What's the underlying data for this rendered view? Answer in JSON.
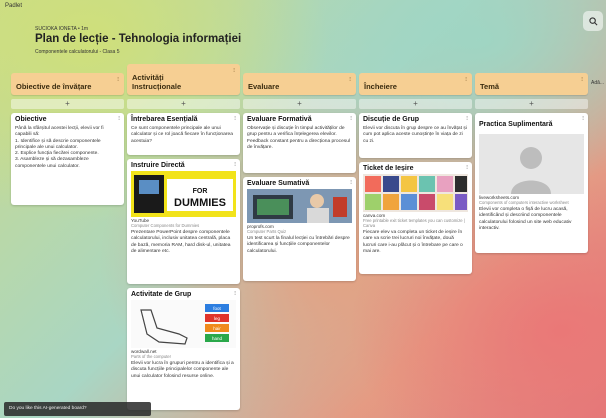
{
  "app": {
    "brand": "Padlet",
    "search_icon": "search-icon"
  },
  "header": {
    "breadcrumb": "SUCIOKA IONETA • 1m",
    "title": "Plan de lecție - Tehnologia informației",
    "subtitle": "Componentele calculatorului - Clasa 5"
  },
  "columns": [
    {
      "label": "Obiective de învățare"
    },
    {
      "label": "Activități Instrucționale"
    },
    {
      "label": "Evaluare"
    },
    {
      "label": "Încheiere"
    },
    {
      "label": "Temă"
    }
  ],
  "add_label": "+",
  "extra_column_hint": "Adă...",
  "cards": {
    "objective": {
      "title": "Obiective",
      "body": "Până la sfârșitul acestei lecții, elevii vor fi capabili să:\n1. Identifice și să descrie componentele principale ale unui calculator.\n2. Explice funcția fiecărei componente.\n3. Asambleze și să dezasambleze componentele unui calculator."
    },
    "essential": {
      "title": "Întrebarea Esențială",
      "body": "Ce sunt componentele principale ale unui calculator și ce rol joacă fiecare în funcționarea acestuia?"
    },
    "direct": {
      "title": "Instruire Directă",
      "source": "YouTube",
      "source2": "Computer Components for Dummies",
      "body": "Prezentare PowerPoint despre componentele calculatorului, inclusiv unitatea centrală, placa de bază, memoria RAM, hard disk-ul, unitatea de alimentare etc.",
      "thumb_text": [
        "DUMMIES",
        "FOR"
      ]
    },
    "group": {
      "title": "Activitate de Grup",
      "source": "wordwall.net",
      "source2": "Parts of the computer",
      "body": "Elevii vor lucra în grupuri pentru a identifica și a discuta funcțiile principalelor componente ale unui calculator folosind resurse online.",
      "tags": [
        "foot",
        "leg",
        "hair",
        "hand"
      ]
    },
    "formative": {
      "title": "Evaluare Formativă",
      "body": "Observație și discuție în timpul activităților de grup pentru a verifica înțelegerea elevilor. Feedback constant pentru a direcționa procesul de învățare."
    },
    "summative": {
      "title": "Evaluare Sumativă",
      "source": "proprofs.com",
      "source2": "Computer Parts Quiz",
      "body": "Un test scurt la finalul lecției cu întrebări despre identificarea și funcțiile componentelor calculatorului."
    },
    "discussion": {
      "title": "Discuție de Grup",
      "body": "Elevii vor discuta în grup despre ce au învățat și cum pot aplica aceste cunoștințe în viața de zi cu zi."
    },
    "exit": {
      "title": "Ticket de Ieșire",
      "source": "canva.com",
      "source2": "Free printable exit ticket templates you can customize | Canva",
      "body": "Fiecare elev va completa un ticket de ieșire în care va scrie trei lucruri noi învățate, două lucruri care i-au plăcut și o întrebare pe care o mai are."
    },
    "practice": {
      "title": "Practica Suplimentară",
      "source": "liveworksheets.com",
      "source2": "Components of computers interactive worksheet",
      "body": "Elevii vor completa o fișă de lucru acasă, identificând și descriind componentele calculatorului folosind un site web educativ interactiv."
    }
  },
  "ai_notice": "Do you like this AI-generated board?",
  "colors": {
    "column_header": "#f6cf93",
    "card": "#ffffff"
  }
}
